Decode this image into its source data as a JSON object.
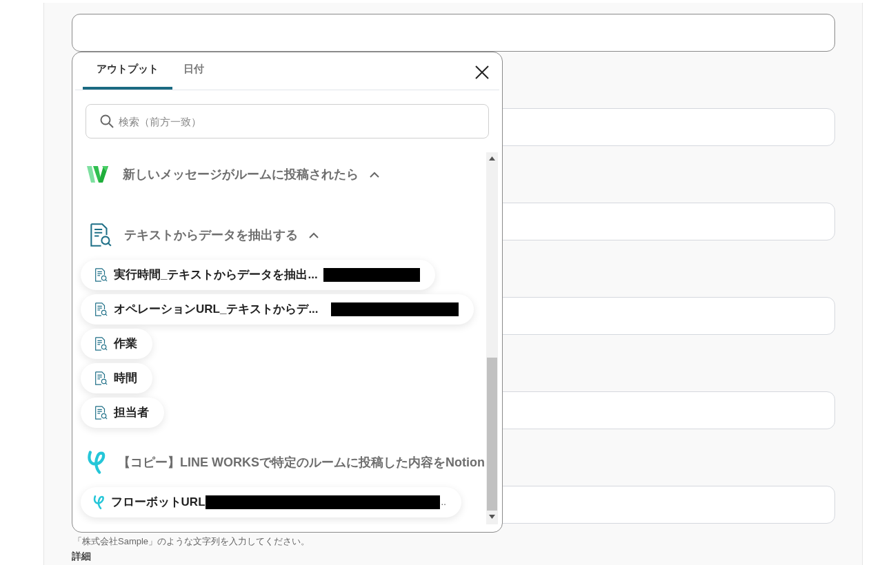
{
  "form": {
    "fields": [
      {
        "focused": true
      },
      {
        "focused": false
      },
      {
        "focused": false
      },
      {
        "focused": false
      },
      {
        "focused": false
      },
      {
        "focused": false
      }
    ],
    "help_text": "「株式会社Sample」のような文字列を入力してください。",
    "next_label": "詳細"
  },
  "popup": {
    "tabs": [
      {
        "label": "アウトプット",
        "selected": true
      },
      {
        "label": "日付",
        "selected": false
      }
    ],
    "search": {
      "placeholder": "検索（前方一致）"
    },
    "groups": [
      {
        "kind": "chat",
        "title": "新しいメッセージがルームに投稿されたら",
        "expanded": true
      },
      {
        "kind": "extract",
        "title": "テキストからデータを抽出する",
        "expanded": true,
        "items": [
          {
            "label": "実行時間_テキストからデータを抽出...",
            "redacted": true
          },
          {
            "label": "オペレーションURL_テキストからデ...",
            "redacted": true
          },
          {
            "label": "作業",
            "redacted": false
          },
          {
            "label": "時間",
            "redacted": false
          },
          {
            "label": "担当者",
            "redacted": false
          }
        ]
      },
      {
        "kind": "flow",
        "title": "【コピー】LINE WORKSで特定のルームに投稿した内容をNotion",
        "items": [
          {
            "label": "フローボットURL",
            "redacted": true,
            "suffix": ".."
          }
        ]
      }
    ]
  }
}
